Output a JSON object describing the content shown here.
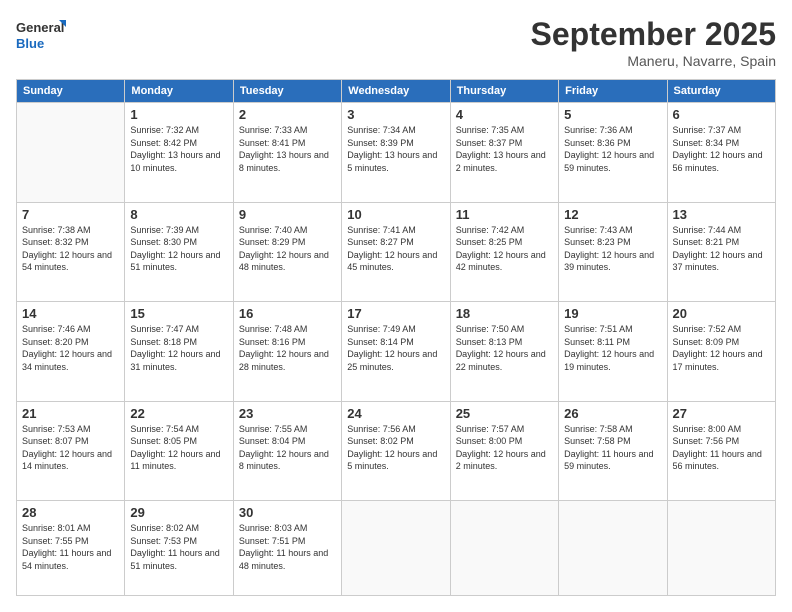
{
  "logo": {
    "line1": "General",
    "line2": "Blue"
  },
  "title": "September 2025",
  "location": "Maneru, Navarre, Spain",
  "weekdays": [
    "Sunday",
    "Monday",
    "Tuesday",
    "Wednesday",
    "Thursday",
    "Friday",
    "Saturday"
  ],
  "weeks": [
    [
      {
        "day": "",
        "info": ""
      },
      {
        "day": "1",
        "info": "Sunrise: 7:32 AM\nSunset: 8:42 PM\nDaylight: 13 hours\nand 10 minutes."
      },
      {
        "day": "2",
        "info": "Sunrise: 7:33 AM\nSunset: 8:41 PM\nDaylight: 13 hours\nand 8 minutes."
      },
      {
        "day": "3",
        "info": "Sunrise: 7:34 AM\nSunset: 8:39 PM\nDaylight: 13 hours\nand 5 minutes."
      },
      {
        "day": "4",
        "info": "Sunrise: 7:35 AM\nSunset: 8:37 PM\nDaylight: 13 hours\nand 2 minutes."
      },
      {
        "day": "5",
        "info": "Sunrise: 7:36 AM\nSunset: 8:36 PM\nDaylight: 12 hours\nand 59 minutes."
      },
      {
        "day": "6",
        "info": "Sunrise: 7:37 AM\nSunset: 8:34 PM\nDaylight: 12 hours\nand 56 minutes."
      }
    ],
    [
      {
        "day": "7",
        "info": "Sunrise: 7:38 AM\nSunset: 8:32 PM\nDaylight: 12 hours\nand 54 minutes."
      },
      {
        "day": "8",
        "info": "Sunrise: 7:39 AM\nSunset: 8:30 PM\nDaylight: 12 hours\nand 51 minutes."
      },
      {
        "day": "9",
        "info": "Sunrise: 7:40 AM\nSunset: 8:29 PM\nDaylight: 12 hours\nand 48 minutes."
      },
      {
        "day": "10",
        "info": "Sunrise: 7:41 AM\nSunset: 8:27 PM\nDaylight: 12 hours\nand 45 minutes."
      },
      {
        "day": "11",
        "info": "Sunrise: 7:42 AM\nSunset: 8:25 PM\nDaylight: 12 hours\nand 42 minutes."
      },
      {
        "day": "12",
        "info": "Sunrise: 7:43 AM\nSunset: 8:23 PM\nDaylight: 12 hours\nand 39 minutes."
      },
      {
        "day": "13",
        "info": "Sunrise: 7:44 AM\nSunset: 8:21 PM\nDaylight: 12 hours\nand 37 minutes."
      }
    ],
    [
      {
        "day": "14",
        "info": "Sunrise: 7:46 AM\nSunset: 8:20 PM\nDaylight: 12 hours\nand 34 minutes."
      },
      {
        "day": "15",
        "info": "Sunrise: 7:47 AM\nSunset: 8:18 PM\nDaylight: 12 hours\nand 31 minutes."
      },
      {
        "day": "16",
        "info": "Sunrise: 7:48 AM\nSunset: 8:16 PM\nDaylight: 12 hours\nand 28 minutes."
      },
      {
        "day": "17",
        "info": "Sunrise: 7:49 AM\nSunset: 8:14 PM\nDaylight: 12 hours\nand 25 minutes."
      },
      {
        "day": "18",
        "info": "Sunrise: 7:50 AM\nSunset: 8:13 PM\nDaylight: 12 hours\nand 22 minutes."
      },
      {
        "day": "19",
        "info": "Sunrise: 7:51 AM\nSunset: 8:11 PM\nDaylight: 12 hours\nand 19 minutes."
      },
      {
        "day": "20",
        "info": "Sunrise: 7:52 AM\nSunset: 8:09 PM\nDaylight: 12 hours\nand 17 minutes."
      }
    ],
    [
      {
        "day": "21",
        "info": "Sunrise: 7:53 AM\nSunset: 8:07 PM\nDaylight: 12 hours\nand 14 minutes."
      },
      {
        "day": "22",
        "info": "Sunrise: 7:54 AM\nSunset: 8:05 PM\nDaylight: 12 hours\nand 11 minutes."
      },
      {
        "day": "23",
        "info": "Sunrise: 7:55 AM\nSunset: 8:04 PM\nDaylight: 12 hours\nand 8 minutes."
      },
      {
        "day": "24",
        "info": "Sunrise: 7:56 AM\nSunset: 8:02 PM\nDaylight: 12 hours\nand 5 minutes."
      },
      {
        "day": "25",
        "info": "Sunrise: 7:57 AM\nSunset: 8:00 PM\nDaylight: 12 hours\nand 2 minutes."
      },
      {
        "day": "26",
        "info": "Sunrise: 7:58 AM\nSunset: 7:58 PM\nDaylight: 11 hours\nand 59 minutes."
      },
      {
        "day": "27",
        "info": "Sunrise: 8:00 AM\nSunset: 7:56 PM\nDaylight: 11 hours\nand 56 minutes."
      }
    ],
    [
      {
        "day": "28",
        "info": "Sunrise: 8:01 AM\nSunset: 7:55 PM\nDaylight: 11 hours\nand 54 minutes."
      },
      {
        "day": "29",
        "info": "Sunrise: 8:02 AM\nSunset: 7:53 PM\nDaylight: 11 hours\nand 51 minutes."
      },
      {
        "day": "30",
        "info": "Sunrise: 8:03 AM\nSunset: 7:51 PM\nDaylight: 11 hours\nand 48 minutes."
      },
      {
        "day": "",
        "info": ""
      },
      {
        "day": "",
        "info": ""
      },
      {
        "day": "",
        "info": ""
      },
      {
        "day": "",
        "info": ""
      }
    ]
  ]
}
